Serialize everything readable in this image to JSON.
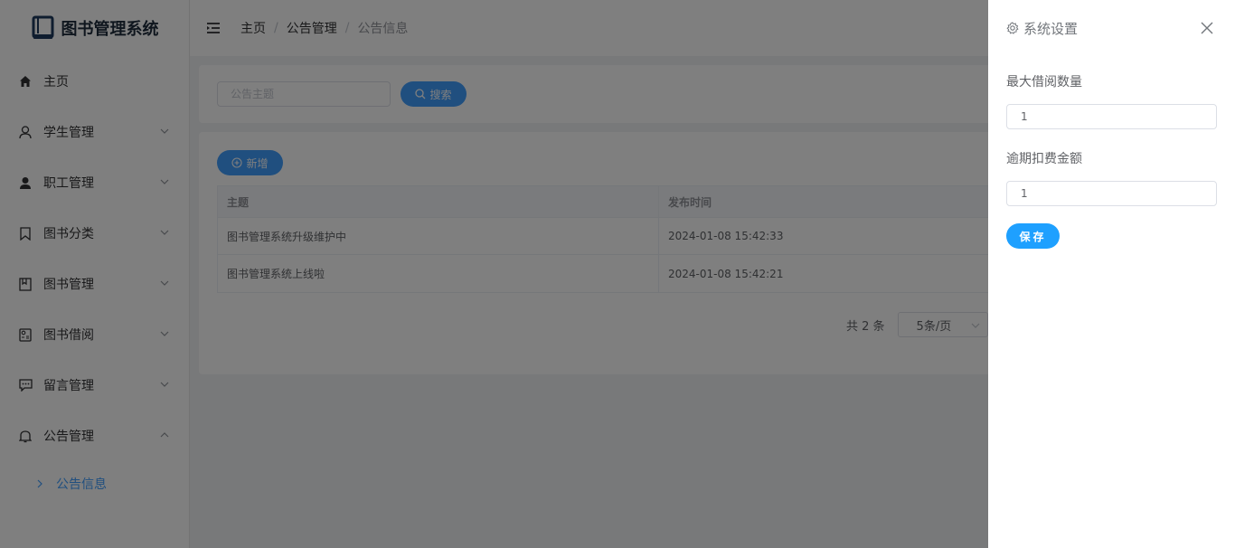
{
  "app": {
    "title": "图书管理系统"
  },
  "breadcrumb": [
    "主页",
    "公告管理",
    "公告信息"
  ],
  "sidebar": {
    "items": [
      {
        "label": "主页",
        "icon": "home-icon"
      },
      {
        "label": "学生管理",
        "icon": "user-outline-icon"
      },
      {
        "label": "职工管理",
        "icon": "user-solid-icon"
      },
      {
        "label": "图书分类",
        "icon": "bookmark-icon"
      },
      {
        "label": "图书管理",
        "icon": "book-icon"
      },
      {
        "label": "图书借阅",
        "icon": "borrow-icon"
      },
      {
        "label": "留言管理",
        "icon": "chat-icon"
      },
      {
        "label": "公告管理",
        "icon": "bell-icon"
      }
    ],
    "sub_item": "公告信息"
  },
  "search": {
    "placeholder": "公告主题",
    "button": "搜索"
  },
  "add_button": "新增",
  "table": {
    "headers": [
      "主题",
      "发布时间"
    ],
    "rows": [
      [
        "图书管理系统升级维护中",
        "2024-01-08 15:42:33"
      ],
      [
        "图书管理系统上线啦",
        "2024-01-08 15:42:21"
      ]
    ]
  },
  "pagination": {
    "total": "共 2 条",
    "page_size": "5条/页"
  },
  "drawer": {
    "title": "系统设置",
    "max_borrow_label": "最大借阅数量",
    "max_borrow_value": "1",
    "overdue_fee_label": "逾期扣费金额",
    "overdue_fee_value": "1",
    "save": "保存"
  },
  "colors": {
    "primary": "#409eff",
    "save": "#1ea0ff",
    "logo": "#1f3a5f"
  }
}
